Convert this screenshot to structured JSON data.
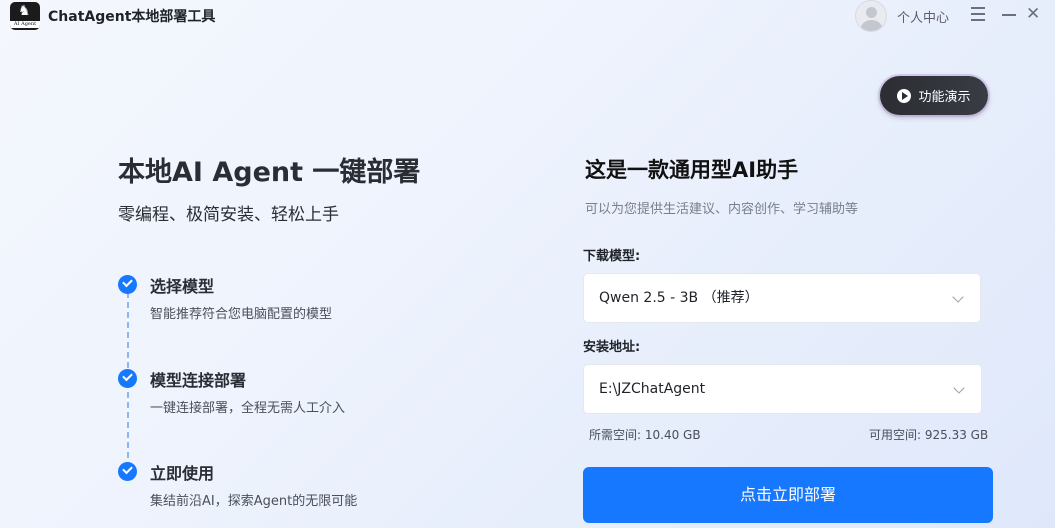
{
  "titlebar": {
    "logo_caption": "AI Agent",
    "app_title": "ChatAgent本地部署工具",
    "user_center": "个人中心"
  },
  "demo": {
    "label": "功能演示"
  },
  "hero": {
    "title": "本地AI Agent 一键部署",
    "subtitle": "零编程、极简安装、轻松上手"
  },
  "steps": [
    {
      "title": "选择模型",
      "desc": "智能推荐符合您电脑配置的模型"
    },
    {
      "title": "模型连接部署",
      "desc": "一键连接部署，全程无需人工介入"
    },
    {
      "title": "立即使用",
      "desc": "集结前沿AI，探索Agent的无限可能"
    }
  ],
  "panel": {
    "title": "这是一款通用型AI助手",
    "subtitle": "可以为您提供生活建议、内容创作、学习辅助等",
    "model_label": "下载模型:",
    "model_value": "Qwen 2.5 - 3B （推荐）",
    "path_label": "安装地址:",
    "path_value": "E:\\JZChatAgent",
    "space_required": "所需空间: 10.40 GB",
    "space_available": "可用空间: 925.33 GB",
    "deploy_label": "点击立即部署"
  },
  "colors": {
    "accent": "#1677ff",
    "dark_button": "#2b2d33"
  }
}
